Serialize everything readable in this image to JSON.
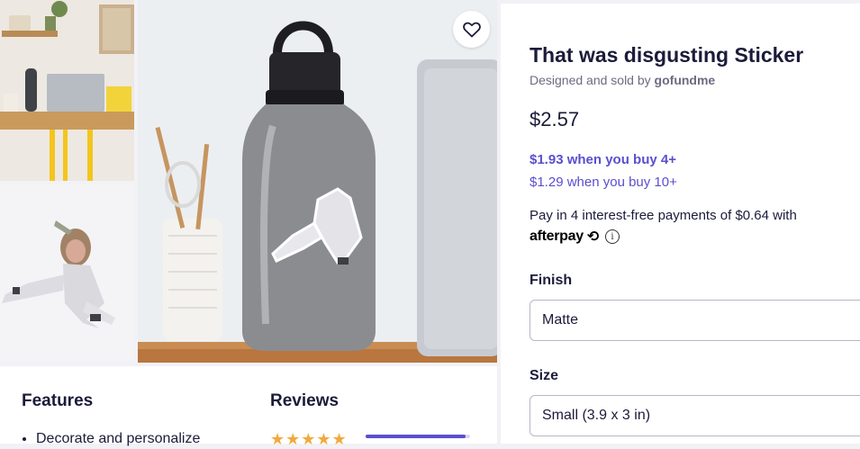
{
  "product": {
    "title": "That was disgusting Sticker",
    "designed_prefix": "Designed and sold by ",
    "designer": "gofundme",
    "price": "$2.57",
    "bulk_4": "$1.93 when you buy 4+",
    "bulk_10": "$1.29 when you buy 10+",
    "pay_text": "Pay in 4 interest-free payments of $0.64 with",
    "afterpay_logo": "afterpay",
    "afterpay_symbol": "⟲",
    "info_symbol": "i"
  },
  "options": {
    "finish_label": "Finish",
    "finish_value": "Matte",
    "size_label": "Size",
    "size_value": "Small (3.9 x 3 in)"
  },
  "sections": {
    "features_title": "Features",
    "features_first": "Decorate and personalize",
    "reviews_title": "Reviews",
    "stars": "★★★★★",
    "review_bar_fill": 0.96
  },
  "colors": {
    "accent": "#5a4fcf",
    "star": "#f2a93b",
    "text": "#1b1b3a"
  },
  "icons": {
    "favorite": "heart-icon",
    "info": "info-icon"
  }
}
